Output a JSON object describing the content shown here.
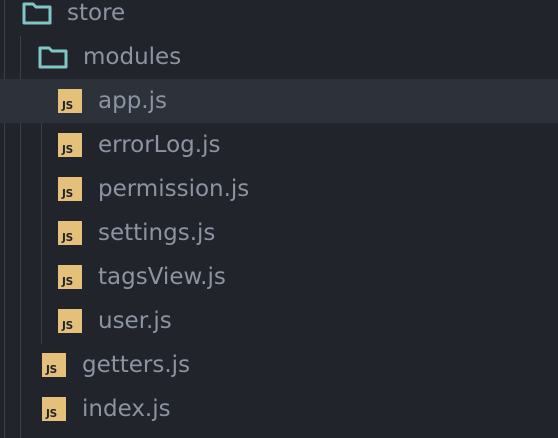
{
  "explorer": {
    "folders": {
      "store": "store",
      "modules": "modules"
    },
    "module_files": [
      {
        "label": "app.js",
        "icon": "JS"
      },
      {
        "label": "errorLog.js",
        "icon": "JS"
      },
      {
        "label": "permission.js",
        "icon": "JS"
      },
      {
        "label": "settings.js",
        "icon": "JS"
      },
      {
        "label": "tagsView.js",
        "icon": "JS"
      },
      {
        "label": "user.js",
        "icon": "JS"
      }
    ],
    "store_files": [
      {
        "label": "getters.js",
        "icon": "JS"
      },
      {
        "label": "index.js",
        "icon": "JS"
      }
    ],
    "icon_names": {
      "folder": "folder-icon",
      "js": "js-file-icon"
    },
    "colors": {
      "background": "#21252b",
      "selected_row": "#2c313a",
      "folder_icon": "#7fc6c6",
      "js_icon": "#e5c07b",
      "text": "#8c93a1"
    },
    "selected": "app.js"
  }
}
